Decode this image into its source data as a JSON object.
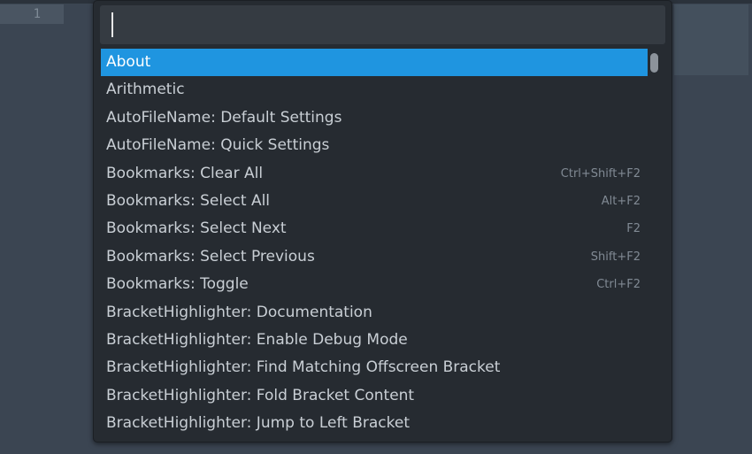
{
  "editor": {
    "line_number": "1"
  },
  "palette": {
    "query": "",
    "items": [
      {
        "label": "About",
        "shortcut": ""
      },
      {
        "label": "Arithmetic",
        "shortcut": ""
      },
      {
        "label": "AutoFileName: Default Settings",
        "shortcut": ""
      },
      {
        "label": "AutoFileName: Quick Settings",
        "shortcut": ""
      },
      {
        "label": "Bookmarks: Clear All",
        "shortcut": "Ctrl+Shift+F2"
      },
      {
        "label": "Bookmarks: Select All",
        "shortcut": "Alt+F2"
      },
      {
        "label": "Bookmarks: Select Next",
        "shortcut": "F2"
      },
      {
        "label": "Bookmarks: Select Previous",
        "shortcut": "Shift+F2"
      },
      {
        "label": "Bookmarks: Toggle",
        "shortcut": "Ctrl+F2"
      },
      {
        "label": "BracketHighlighter: Documentation",
        "shortcut": ""
      },
      {
        "label": "BracketHighlighter: Enable Debug Mode",
        "shortcut": ""
      },
      {
        "label": "BracketHighlighter: Find Matching Offscreen Bracket",
        "shortcut": ""
      },
      {
        "label": "BracketHighlighter: Fold Bracket Content",
        "shortcut": ""
      },
      {
        "label": "BracketHighlighter: Jump to Left Bracket",
        "shortcut": ""
      }
    ]
  },
  "colors": {
    "selection": "#1f95e0",
    "palette_bg": "#262b31",
    "editor_bg": "#3b4552"
  }
}
